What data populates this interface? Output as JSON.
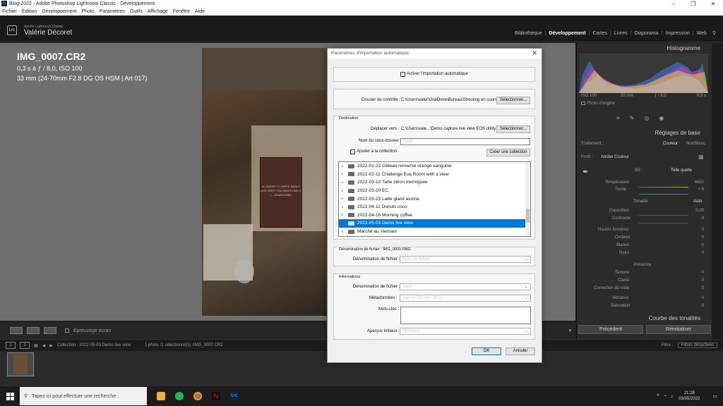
{
  "window": {
    "title": "Blog-2022 - Adobe Photoshop Lightroom Classic - Développement"
  },
  "menu": [
    "Fichier",
    "Edition",
    "Développement",
    "Photo",
    "Paramètres",
    "Outils",
    "Affichage",
    "Fenêtre",
    "Aide"
  ],
  "lr": {
    "logo": "Lrc",
    "sub": "Adobe Lightroom Classic",
    "user": "Valérie Décoret",
    "modules": [
      "Bibliothèque",
      "Développement",
      "Cartes",
      "Livres",
      "Diaporama",
      "Impression",
      "Web"
    ],
    "active_module": "Développement"
  },
  "image": {
    "name": "IMG_0007.CR2",
    "line1": "0,3 s à ƒ / 8,0, ISO 100",
    "line2": "33 mm (24-70mm F2.8 DG OS HSM | Art 017)",
    "book_text": "IN ORDER TO WRITE ABOUT LIFE FIRST YOU MUST LIVE IT — HEMINGWAY"
  },
  "toolbar": {
    "soft_proof": "Epreuvage écran"
  },
  "right_panel": {
    "histogram": "Histogramme",
    "hist_iso": "ISO 100",
    "hist_focal": "33 mm",
    "hist_aperture": "ƒ / 8,0",
    "hist_shutter": "0,3 s",
    "original_photo": "Photo d'origine",
    "basic": "Réglages de base",
    "treatment": "Traitement :",
    "color": "Couleur",
    "bw": "Noir/blanc",
    "profile_label": "Profil :",
    "profile_value": "Adobe Couleur",
    "wb_label": "BB :",
    "wb_value": "Telle quelle",
    "temperature": "Température",
    "temperature_value": "4650",
    "tint": "Teinte",
    "tint_value": "+ 8",
    "tone": "Tonalité",
    "auto": "Auto",
    "exposure": "Exposition",
    "exposure_value": "0,00",
    "contrast": "Contraste",
    "contrast_value": "0",
    "highlights": "Hautes lumières",
    "highlights_value": "0",
    "shadows": "Ombres",
    "shadows_value": "0",
    "whites": "Blancs",
    "whites_value": "0",
    "blacks": "Noirs",
    "blacks_value": "0",
    "presence": "Présence",
    "texture": "Texture",
    "texture_value": "0",
    "clarity": "Clarté",
    "clarity_value": "0",
    "dehaze": "Correction du voile",
    "dehaze_value": "0",
    "vibrance": "Vibrance",
    "vibrance_value": "0",
    "saturation": "Saturation",
    "saturation_value": "0",
    "tone_curve": "Courbe des tonalités",
    "previous": "Précédent",
    "reset": "Réinitialiser"
  },
  "filmbar": {
    "n1": "1",
    "n2": "2",
    "collection": "Collection : 2022-05-03 Demo live view",
    "count": "1 photo /1 sélectionné(s) /IMG_0007.CR2",
    "filter_label": "Filtre :",
    "filter_value": "Filtres désactivés"
  },
  "dialog": {
    "title": "Paramètres d'importation automatique",
    "enable": "Activer l'importation automatique",
    "watch_label": "Dossier de contrôle :",
    "watch_path": "C:\\Users\\valer\\OneDrive\\Bureau\\Shooting en cours",
    "select": "Sélectionner...",
    "destination": "Destination",
    "move_label": "Déplacer vers :",
    "move_path": "C:\\Users\\vale...\\Demo capture live view EOS utility",
    "subfolder_label": "Nom du sous-dossier :",
    "subfolder_value": "RAW",
    "add_collection": "Ajouter à la collection",
    "create_collection": "Créer une collection",
    "collections": [
      "2022-01-22 Gâteau renversé orange sanguine",
      "2022-02-11 Challenge Eva Room with a view",
      "2022-03-10 Tarte citron meringuée",
      "2022-03-20 EC",
      "2022-03-23 Latte glacé avoine",
      "2022-04-11 Donuts coco",
      "2022-04-16 Morning coffee",
      "2022-05-03 Demo live view",
      "Marché au Vietnam"
    ],
    "selected_index": 7,
    "naming_group": "Dénomination de fichier : IMG_0001.DNG",
    "naming_label": "Dénomination de fichier :",
    "naming_value": "Nom du fichier",
    "info_group": "Informations",
    "dev_label": "Dénomination de fichier :",
    "dev_value": "Sans",
    "meta_label": "Métadonnées :",
    "meta_value": "Valérie Décoret 2022",
    "keywords_label": "Mots-clés :",
    "preview_label": "Aperçus initiaux :",
    "preview_value": "Minimum",
    "ok": "OK",
    "cancel": "Annuler"
  },
  "taskbar": {
    "search_placeholder": "Tapez ici pour effectuer une recherche",
    "time": "21:28",
    "date": "03/05/2022"
  },
  "colors": {
    "accent": "#0078d7",
    "panel": "#2b2b2b",
    "viewer": "#6f6f6f"
  }
}
